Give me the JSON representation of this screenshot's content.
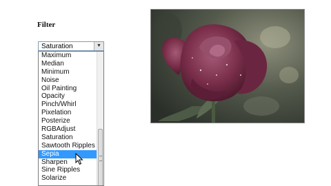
{
  "filter_heading": "Filter",
  "select": {
    "value": "Saturation",
    "options": [
      "Maximum",
      "Median",
      "Minimum",
      "Noise",
      "Oil Painting",
      "Opacity",
      "Pinch/Whirl",
      "Pixelation",
      "Posterize",
      "RGBAdjust",
      "Saturation",
      "Sawtooth Ripples",
      "Sepia",
      "Sharpen",
      "Sine Ripples",
      "Solarize"
    ],
    "highlighted": "Sepia"
  },
  "colors": {
    "highlight": "#3399ff",
    "rose": "#7a2e4a",
    "photo_background": "#3d4338"
  }
}
